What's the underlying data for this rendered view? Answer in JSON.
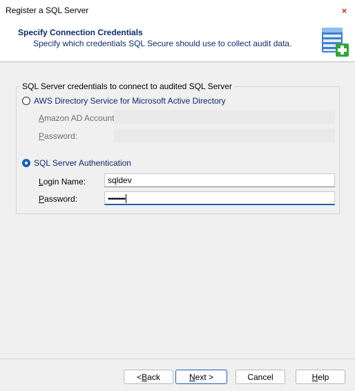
{
  "window": {
    "title": "Register a SQL Server",
    "close_glyph": "×"
  },
  "header": {
    "title": "Specify Connection Credentials",
    "subtitle": "Specify which credentials SQL Secure should use to collect audit data.",
    "icon": "database-add-icon"
  },
  "credentials": {
    "group_label": "SQL Server credentials to connect to audited SQL Server",
    "aws": {
      "option_label": "AWS Directory Service for Microsoft Active Directory",
      "selected": false,
      "account_label_first": "A",
      "account_label_rest": "mazon AD Account:",
      "account_value": "",
      "password_label_first": "P",
      "password_label_rest": "assword:",
      "password_value": ""
    },
    "sql_auth": {
      "option_label": "SQL Server Authentication",
      "selected": true,
      "login_label_first": "L",
      "login_label_rest": "ogin Name:",
      "login_value": "sqldev",
      "password_label_first": "P",
      "password_label_rest": "assword:",
      "password_mask": "••••••••••"
    }
  },
  "buttons": {
    "back_prefix": "< ",
    "back_hot": "B",
    "back_rest": "ack",
    "next_hot": "N",
    "next_rest": "ext >",
    "cancel": "Cancel",
    "help_hot": "H",
    "help_rest": "elp"
  },
  "colors": {
    "accent": "#1a5fb4",
    "header_text": "#0b2a6f",
    "close": "#c42b1c"
  }
}
